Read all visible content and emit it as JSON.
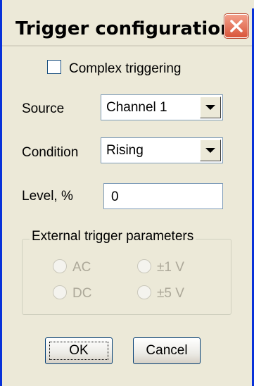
{
  "window": {
    "title": "Trigger configuration"
  },
  "complex": {
    "label": "Complex triggering",
    "checked": false
  },
  "source": {
    "label": "Source",
    "value": "Channel 1"
  },
  "condition": {
    "label": "Condition",
    "value": "Rising"
  },
  "level": {
    "label": "Level, %",
    "value": "0"
  },
  "external": {
    "title": "External trigger parameters",
    "radios": [
      {
        "label": "AC",
        "enabled": false
      },
      {
        "label": "DC",
        "enabled": false
      },
      {
        "label": "±1 V",
        "enabled": false
      },
      {
        "label": "±5 V",
        "enabled": false
      }
    ]
  },
  "buttons": {
    "ok": "OK",
    "cancel": "Cancel"
  },
  "icons": {
    "close": "close-icon",
    "dropdown": "chevron-down-icon"
  },
  "colors": {
    "frame": "#0831d9",
    "dialog_bg": "#ece9d8",
    "close_button": "#d9553a",
    "disabled_text": "#aca899"
  }
}
